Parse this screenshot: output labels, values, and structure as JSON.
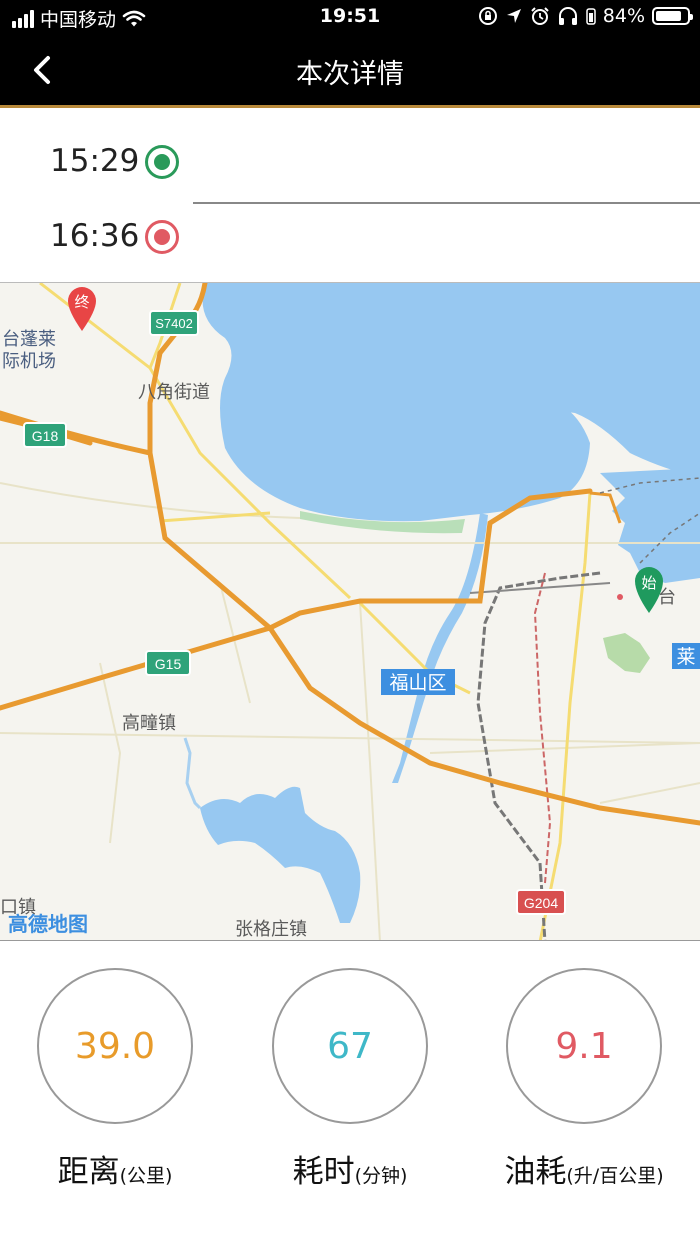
{
  "status_bar": {
    "carrier": "中国移动",
    "time": "19:51",
    "battery": "84%",
    "battery_level": 0.84
  },
  "nav": {
    "title": "本次详情"
  },
  "trip": {
    "start_time": "15:29",
    "end_time": "16:36"
  },
  "map": {
    "start_marker": "始",
    "end_marker": "终",
    "logo": "高德地图",
    "labels": {
      "airport_line1": "台蓬莱",
      "airport_line2": "际机场",
      "bajiao": "八角街道",
      "gaotong": "高疃镇",
      "fushan": "福山区",
      "zhanggezhuang": "张格庄镇",
      "kouzhen": "口镇",
      "tai": "台",
      "lai": "莱"
    },
    "shields": {
      "s7402": "S7402",
      "g18": "G18",
      "g15": "G15",
      "g204": "G204"
    }
  },
  "stats": [
    {
      "value": "39.0",
      "label": "距离",
      "unit": "(公里)",
      "color": "#e89b2a"
    },
    {
      "value": "67",
      "label": "耗时",
      "unit": "(分钟)",
      "color": "#3fb8c8"
    },
    {
      "value": "9.1",
      "label": "油耗",
      "unit": "(升/百公里)",
      "color": "#e05a63"
    }
  ]
}
